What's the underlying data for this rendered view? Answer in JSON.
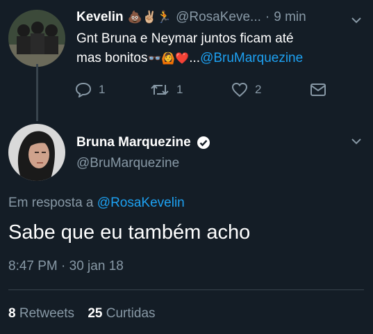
{
  "reply": {
    "author_name": "Kevelin",
    "author_emojis": "💩✌🏼🏃",
    "handle": "@RosaKeve...",
    "sep": "·",
    "time": "9 min",
    "text_line1": "Gnt Bruna e Neymar juntos ficam até",
    "text_line2_prefix": "mas bonitos",
    "text_line2_emojis": "👓🙆❤️",
    "ellipsis": "...",
    "mention": "@BruMarquezine",
    "replies_count": "1",
    "retweets_count": "1",
    "likes_count": "2"
  },
  "main": {
    "author_name": "Bruna Marquezine",
    "handle": "@BruMarquezine",
    "in_reply_prefix": "Em resposta a",
    "in_reply_handle": "@RosaKevelin",
    "text": "Sabe que eu também acho",
    "timestamp": "8:47 PM · 30 jan 18",
    "retweets_count": "8",
    "retweets_label": "Retweets",
    "likes_count": "25",
    "likes_label": "Curtidas"
  },
  "colors": {
    "background": "#141d26",
    "accent": "#1da1f2",
    "muted": "#8899a6",
    "divider": "#38444d"
  },
  "icons": {
    "reply": "reply-icon",
    "retweet": "retweet-icon",
    "like": "heart-icon",
    "dm": "envelope-icon",
    "verified": "verified-badge-icon",
    "more": "chevron-down-icon"
  }
}
